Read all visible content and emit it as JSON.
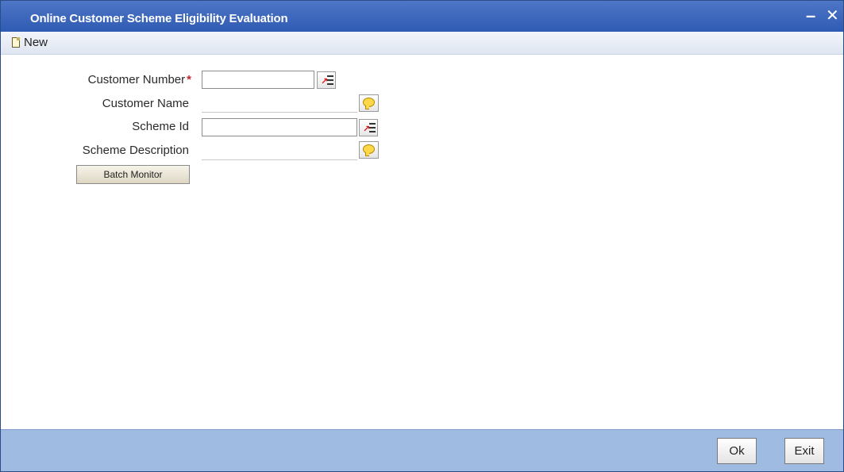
{
  "window": {
    "title": "Online Customer Scheme Eligibility Evaluation",
    "minimize_icon": "minimize-icon",
    "close_icon": "close-icon"
  },
  "toolbar": {
    "new_label": "New",
    "new_icon": "new-document-icon"
  },
  "form": {
    "customer_number": {
      "label": "Customer Number",
      "value": "",
      "required_mark": "*"
    },
    "customer_name": {
      "label": "Customer Name",
      "value": ""
    },
    "scheme_id": {
      "label": "Scheme Id",
      "value": ""
    },
    "scheme_description": {
      "label": "Scheme Description",
      "value": ""
    },
    "batch_monitor_label": "Batch Monitor"
  },
  "footer": {
    "ok_label": "Ok",
    "exit_label": "Exit"
  },
  "colors": {
    "titlebar": "#3a65bd",
    "footer": "#9fbbe2",
    "required": "#c0272d"
  }
}
